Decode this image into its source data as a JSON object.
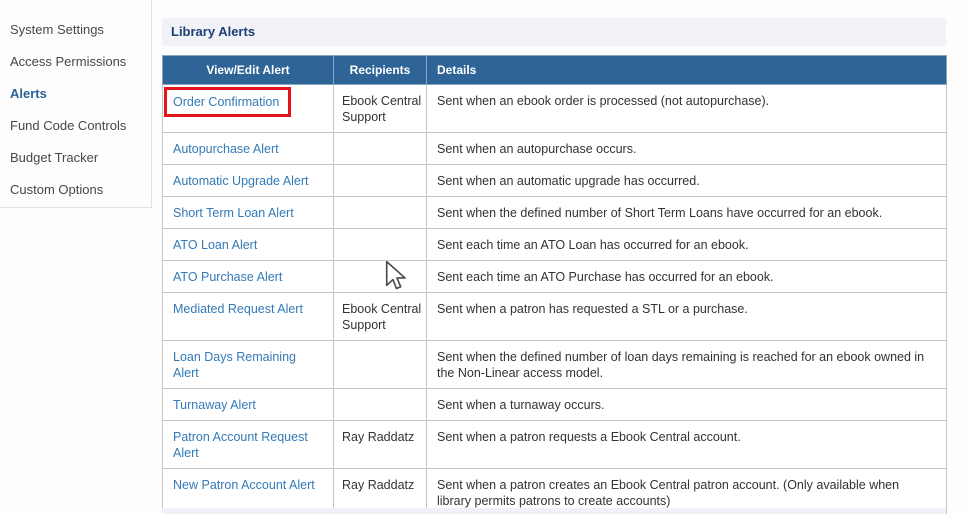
{
  "sidebar": {
    "items": [
      {
        "label": "System Settings",
        "active": false
      },
      {
        "label": "Access Permissions",
        "active": false
      },
      {
        "label": "Alerts",
        "active": true
      },
      {
        "label": "Fund Code Controls",
        "active": false
      },
      {
        "label": "Budget Tracker",
        "active": false
      },
      {
        "label": "Custom Options",
        "active": false
      }
    ]
  },
  "main": {
    "section_title": "Library Alerts",
    "table": {
      "columns": [
        "View/Edit Alert",
        "Recipients",
        "Details"
      ],
      "rows": [
        {
          "alert": "Order Confirmation",
          "recipients": "Ebook Central Support",
          "details": "Sent when an ebook order is processed (not autopurchase).",
          "highlighted": true
        },
        {
          "alert": "Autopurchase Alert",
          "recipients": "",
          "details": "Sent when an autopurchase occurs.",
          "highlighted": false
        },
        {
          "alert": "Automatic Upgrade Alert",
          "recipients": "",
          "details": "Sent when an automatic upgrade has occurred.",
          "highlighted": false
        },
        {
          "alert": "Short Term Loan Alert",
          "recipients": "",
          "details": "Sent when the defined number of Short Term Loans have occurred for an ebook.",
          "highlighted": false
        },
        {
          "alert": "ATO Loan Alert",
          "recipients": "",
          "details": "Sent each time an ATO Loan has occurred for an ebook.",
          "highlighted": false
        },
        {
          "alert": "ATO Purchase Alert",
          "recipients": "",
          "details": "Sent each time an ATO Purchase has occurred for an ebook.",
          "highlighted": false
        },
        {
          "alert": "Mediated Request Alert",
          "recipients": "Ebook Central Support",
          "details": "Sent when a patron has requested a STL or a purchase.",
          "highlighted": false
        },
        {
          "alert": "Loan Days Remaining Alert",
          "recipients": "",
          "details": "Sent when the defined number of loan days remaining is reached for an ebook owned in the Non-Linear access model.",
          "highlighted": false
        },
        {
          "alert": "Turnaway Alert",
          "recipients": "",
          "details": "Sent when a turnaway occurs.",
          "highlighted": false
        },
        {
          "alert": "Patron Account Request Alert",
          "recipients": "Ray Raddatz",
          "details": "Sent when a patron requests a Ebook Central account.",
          "highlighted": false
        },
        {
          "alert": "New Patron Account Alert",
          "recipients": "Ray Raddatz",
          "details": "Sent when a patron creates an Ebook Central patron account. (Only available when library permits patrons to create accounts)",
          "highlighted": false
        }
      ]
    }
  },
  "colors": {
    "table_header_bg": "#2e6496",
    "link": "#337ab7",
    "section_title_text": "#1e4175",
    "section_bar_bg": "#f1f1f8",
    "highlight_box": "#e3131b",
    "sidebar_active": "#2a6496"
  }
}
